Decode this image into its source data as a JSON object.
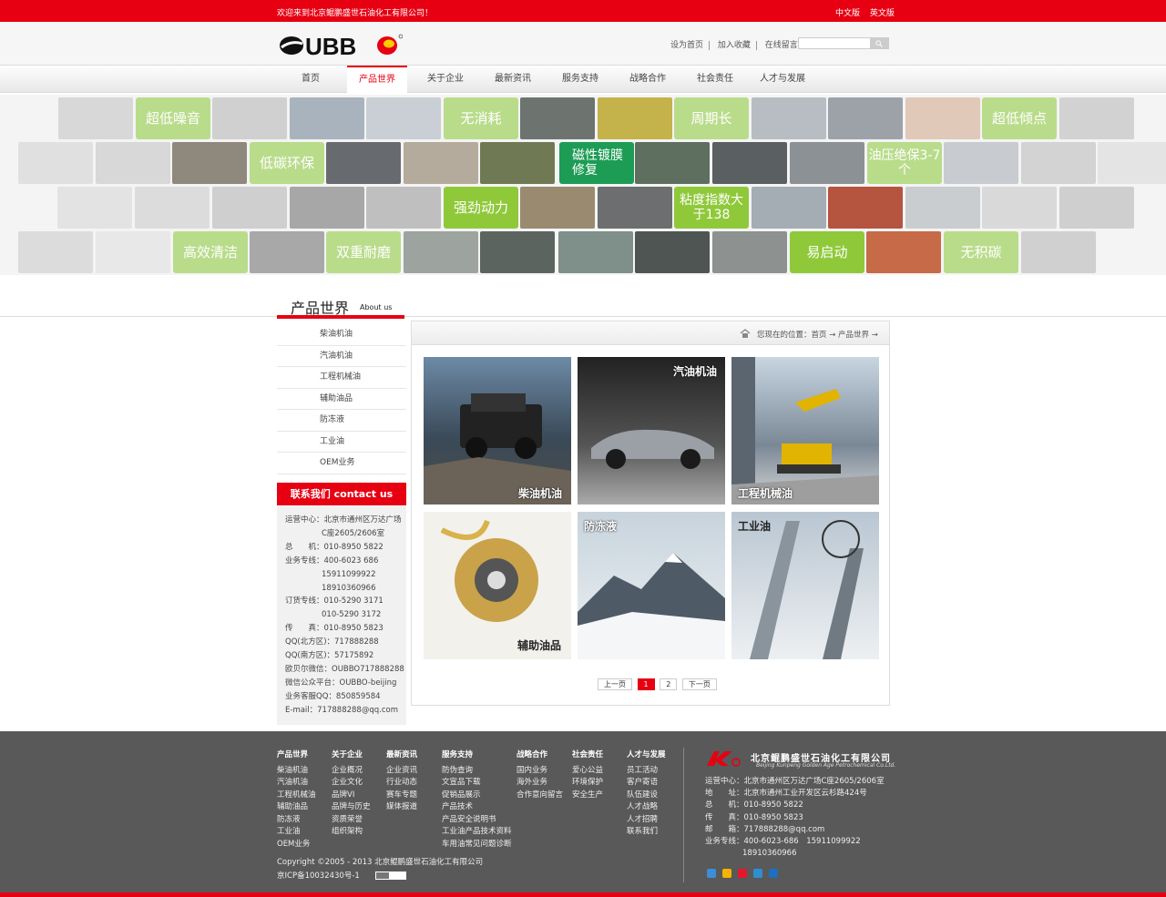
{
  "topbar": {
    "welcome": "欢迎来到北京鲲鹏盛世石油化工有限公司！",
    "lang_cn": "中文版",
    "lang_en": "英文版"
  },
  "header": {
    "logo_text": "OUBBO",
    "links": [
      "设为首页",
      "加入收藏",
      "在线留言"
    ],
    "search_placeholder": ""
  },
  "nav": {
    "items": [
      "首页",
      "产品世界",
      "关于企业",
      "最新资讯",
      "服务支持",
      "战略合作",
      "社会责任",
      "人才与发展"
    ],
    "active_index": 1
  },
  "banner": {
    "tiles": [
      "超低噪音",
      "无消耗",
      "周期长",
      "超低倾点",
      "低碳环保",
      "磁性镀膜修复",
      "油压绝保3-7个",
      "强劲动力",
      "粘度指数大于138",
      "高效清洁",
      "双重耐磨",
      "易启动",
      "无积碳"
    ]
  },
  "section": {
    "title_cn": "产品世界",
    "title_en": "About us"
  },
  "side_menu": [
    "柴油机油",
    "汽油机油",
    "工程机械油",
    "辅助油品",
    "防冻液",
    "工业油",
    "OEM业务"
  ],
  "contact": {
    "heading": "联系我们 contact us",
    "lines": [
      "运营中心：北京市通州区万达广场",
      "C座2605/2606室",
      "总　　机：010-8950 5822",
      "业务专线：400-6023 686",
      "15911099922",
      "18910360966",
      "订货专线：010-5290 3171",
      "010-5290 3172",
      "传　　真：010-8950 5823",
      "QQ(北方区)：717888288",
      "QQ(南方区)：57175892",
      "欧贝尔微信：OUBBO717888288",
      "微信公众平台：OUBBO-beijing",
      "业务客服QQ：850859584",
      "E-mail：717888288@qq.com"
    ]
  },
  "breadcrumb": {
    "text": "您现在的位置：首页 → 产品世界 →"
  },
  "products": [
    "柴油机油",
    "汽油机油",
    "工程机械油",
    "辅助油品",
    "防冻液",
    "工业油"
  ],
  "pager": {
    "prev": "上一页",
    "pages": [
      "1",
      "2"
    ],
    "current": "1",
    "next": "下一页"
  },
  "footer": {
    "columns": [
      {
        "title": "产品世界",
        "items": [
          "柴油机油",
          "汽油机油",
          "工程机械油",
          "辅助油品",
          "防冻液",
          "工业油",
          "OEM业务"
        ]
      },
      {
        "title": "关于企业",
        "items": [
          "企业概况",
          "企业文化",
          "品牌VI",
          "品牌与历史",
          "资质荣誉",
          "组织架构"
        ]
      },
      {
        "title": "最新资讯",
        "items": [
          "企业资讯",
          "行业动态",
          "赛车专题",
          "媒体报道"
        ]
      },
      {
        "title": "服务支持",
        "items": [
          "防伪查询",
          "文宣品下载",
          "促销品展示",
          "产品技术",
          "产品安全说明书",
          "工业油产品技术资料",
          "车用油常见问题诊断"
        ]
      },
      {
        "title": "战略合作",
        "items": [
          "国内业务",
          "海外业务",
          "合作意向留言"
        ]
      },
      {
        "title": "社会责任",
        "items": [
          "爱心公益",
          "环境保护",
          "安全生产"
        ]
      },
      {
        "title": "人才与发展",
        "items": [
          "员工活动",
          "客户寄语",
          "队伍建设",
          "人才战略",
          "人才招聘",
          "联系我们"
        ]
      }
    ],
    "copyright": "Copyright ©2005 - 2013 北京鲲鹏盛世石油化工有限公司",
    "icp": "京ICP备10032430号-1",
    "company_cn": "北京鲲鹏盛世石油化工有限公司",
    "company_en": "Beijing Kunpeng Golden Age Petrochemical Co.Ltd.",
    "info": [
      "运营中心：北京市通州区万达广场C座2605/2606室",
      "地　　址：北京市通州工业开发区云杉路424号",
      "总　　机：010-8950 5822",
      "传　　真：010-8950 5823",
      "邮　　箱：717888288@qq.com",
      "业务专线：400-6023-686　15911099922",
      "18910360966"
    ]
  },
  "colors": {
    "brand_red": "#e60012",
    "footer_gray": "#595959",
    "tile_green": "#1d9c55"
  }
}
